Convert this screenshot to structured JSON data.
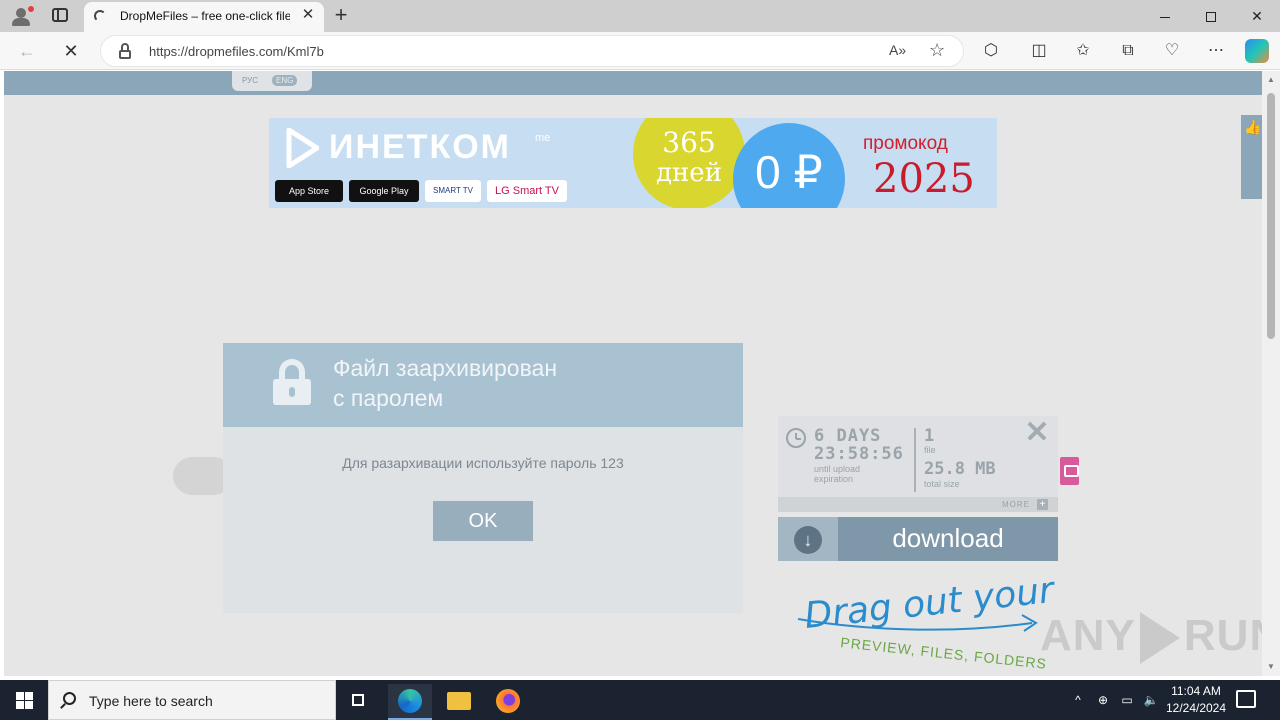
{
  "browser": {
    "tab_title": "DropMeFiles – free one-click file",
    "tab_close": "✕",
    "new_tab": "+",
    "url": "https://dropmefiles.com/Kml7b",
    "read_aloud": "A»",
    "favorite": "☆",
    "tools": [
      "⬡",
      "◫",
      "✩",
      "⧉",
      "♡",
      "⋯"
    ]
  },
  "page": {
    "lang_ru": "РУС",
    "lang_en": "ENG",
    "banner": {
      "brand": "ИНЕТКОМ",
      "brand_sup": "me",
      "stores": [
        "App Store",
        "Google Play",
        "SMART TV",
        "LG Smart TV"
      ],
      "days_number": "365",
      "days_word": "дней",
      "price": "0 ₽",
      "promo_label": "промокод",
      "promo_year": "2025"
    },
    "modal": {
      "title_line1": "Файл заархивирован",
      "title_line2": "с паролем",
      "message": "Для разархивации используйте пароль 123",
      "ok": "OK"
    },
    "file_info": {
      "days": "6 DAYS",
      "time": "23:58:56",
      "expiration_label": "until upload expiration",
      "file_count": "1",
      "file_label": "file",
      "total_size": "25.8 MB",
      "total_size_label": "total size",
      "more": "MORE",
      "more_plus": "+",
      "close": "✕"
    },
    "download": {
      "icon": "↓",
      "label": "download"
    },
    "drag": {
      "line1": "Drag out your",
      "line2": "PREVIEW, FILES, FOLDERS"
    },
    "watermark_left": "ANY",
    "watermark_right": "RUN"
  },
  "taskbar": {
    "search_placeholder": "Type here to search",
    "time": "11:04 AM",
    "date": "12/24/2024",
    "tray_icons": [
      "^",
      "⊕",
      "▭",
      "🔈"
    ]
  }
}
